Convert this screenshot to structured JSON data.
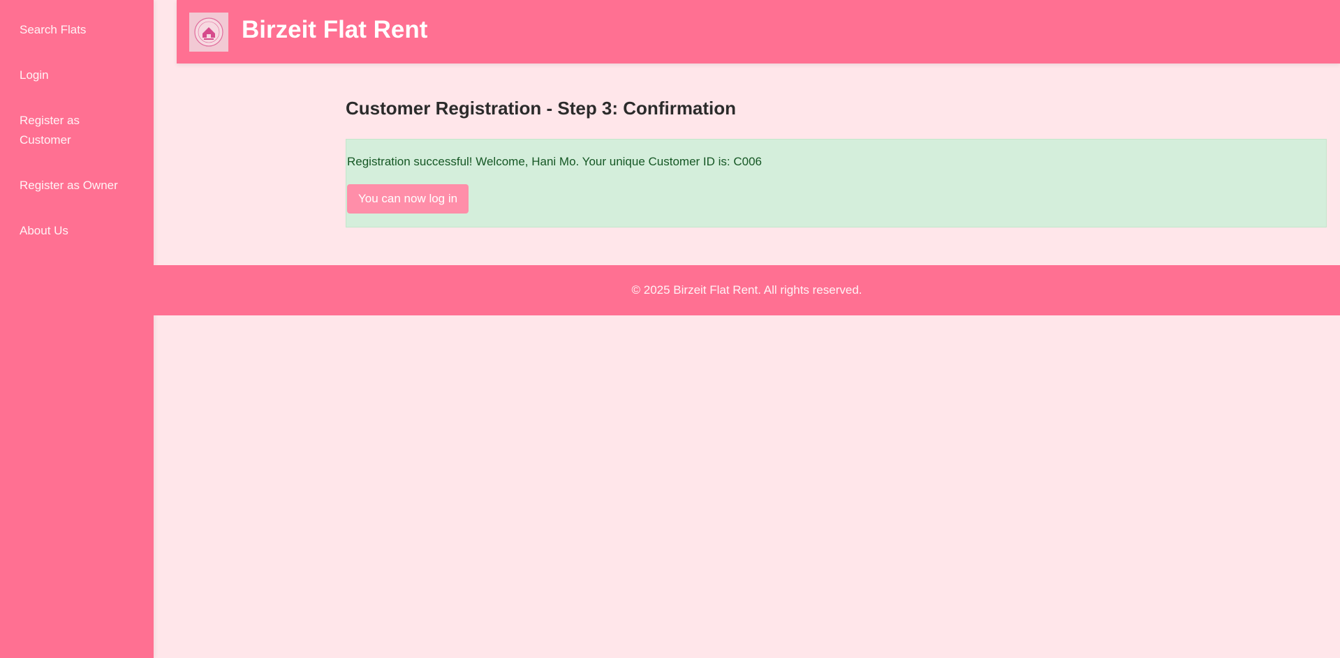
{
  "sidebar": {
    "items": [
      {
        "label": "Search Flats"
      },
      {
        "label": "Login"
      },
      {
        "label": "Register as Customer"
      },
      {
        "label": "Register as Owner"
      },
      {
        "label": "About Us"
      }
    ]
  },
  "header": {
    "logo_icon": "house-seal-logo",
    "title": "Birzeit Flat Rent"
  },
  "main": {
    "heading": "Customer Registration - Step 3: Confirmation",
    "success_message": "Registration successful! Welcome, Hani Mo. Your unique Customer ID is: C006",
    "login_button_label": "You can now log in"
  },
  "footer": {
    "text": "© 2025 Birzeit Flat Rent. All rights reserved."
  },
  "colors": {
    "primary_pink": "#ff7092",
    "page_background": "#ffe6ea",
    "success_background": "#d4eedb",
    "success_text": "#155724",
    "button_pink": "#ff8ea9"
  }
}
